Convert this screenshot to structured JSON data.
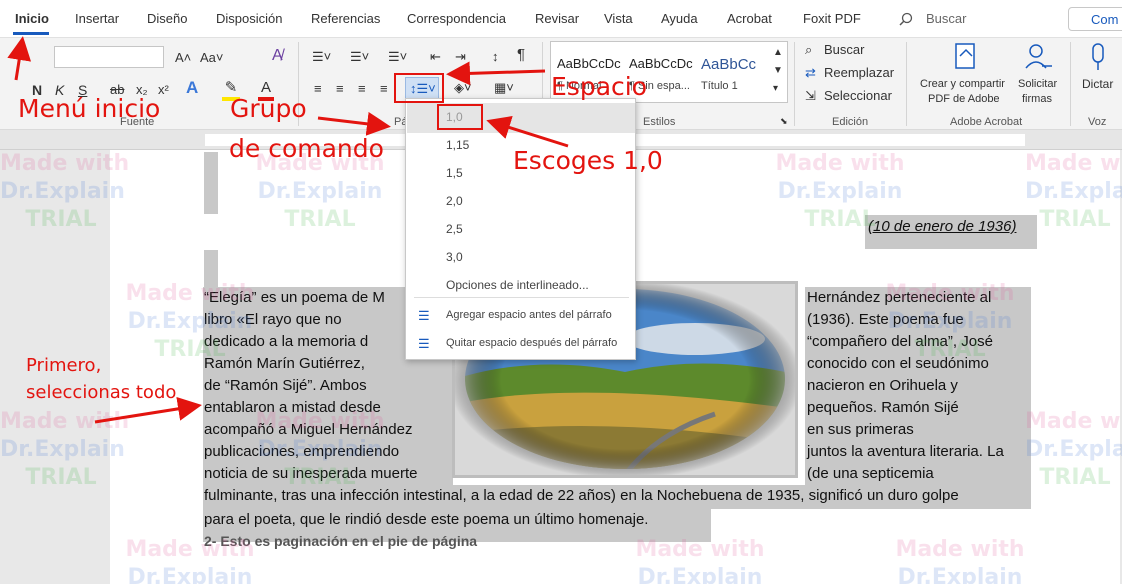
{
  "tabs": [
    "Inicio",
    "Insertar",
    "Diseño",
    "Disposición",
    "Referencias",
    "Correspondencia",
    "Revisar",
    "Vista",
    "Ayuda",
    "Acrobat",
    "Foxit PDF"
  ],
  "search": {
    "label": "Buscar"
  },
  "share": {
    "label": "Com"
  },
  "ribbon": {
    "font_group": "Fuente",
    "paragraph_group": "Pá",
    "styles_group": "Estilos",
    "edit_group": "Edición",
    "adobe_group": "Adobe Acrobat",
    "voice_group": "Voz",
    "font_buttons": [
      "N",
      "K",
      "S",
      "ab",
      "x₂",
      "x²"
    ],
    "styles": [
      {
        "sample": "AaBbCcDc",
        "name": "¶ Normal"
      },
      {
        "sample": "AaBbCcDc",
        "name": "¶ Sin espa..."
      },
      {
        "sample": "AaBbCc",
        "name": "Título 1"
      }
    ],
    "edit": {
      "find": "Buscar",
      "replace": "Reemplazar",
      "select": "Seleccionar"
    },
    "adobe": {
      "create": "Crear y compartir",
      "create2": "PDF de Adobe",
      "sign": "Solicitar",
      "sign2": "firmas"
    },
    "voice": {
      "dictate": "Dictar"
    }
  },
  "spacing_menu": {
    "options": [
      "1,0",
      "1,15",
      "1,5",
      "2,0",
      "2,5",
      "3,0"
    ],
    "more": "Opciones de interlineado...",
    "add_before": "Agregar espacio antes del párrafo",
    "remove_after": "Quitar espacio después del párrafo"
  },
  "document": {
    "date": "(10 de enero de 1936)",
    "left_lines": [
      " “Elegía” es un poema de M",
      "libro «El rayo que no",
      "dedicado a la memoria d",
      "Ramón     Marín     Gutiérrez,",
      "de  “Ramón  Sijé”.  Ambos",
      "entablaron   a   mistad   desde",
      "acompañó a Miguel Hernández",
      "publicaciones,   emprendiendo",
      "noticia de su inesperada muerte"
    ],
    "right_lines": [
      "Hernández  perteneciente  al",
      "(1936).   Este   poema   fue",
      "“compañero del alma”, José",
      "conocido  con  el  seudónimo",
      "nacieron     en     Orihuela     y",
      "pequeños.       Ramón       Sijé",
      "en             sus             primeras",
      "juntos la aventura literaria. La",
      "(de           una           septicemia"
    ],
    "full_lines": [
      "fulminante, tras una infección intestinal, a la edad de 22 años) en la Nochebuena de 1935, significó un duro golpe",
      "para el poeta, que le rindió desde este poema un último homenaje."
    ],
    "footer_line": "2- Esto es paginación en el pie de página"
  },
  "annotations": {
    "menu_inicio": "Menú inicio",
    "grupo": "Grupo",
    "de_comando": "de comando",
    "espacio": "Espacio",
    "escoges": "Escoges 1,0",
    "primero": "Primero,",
    "selecciona": "seleccionas todo"
  },
  "watermark": {
    "line1": "Made with",
    "line2": "Dr.Explain",
    "line3": "TRIAL"
  },
  "colors": {
    "accent": "#185abd",
    "annotation": "#e3140f",
    "selection": "#c8c8c8"
  }
}
